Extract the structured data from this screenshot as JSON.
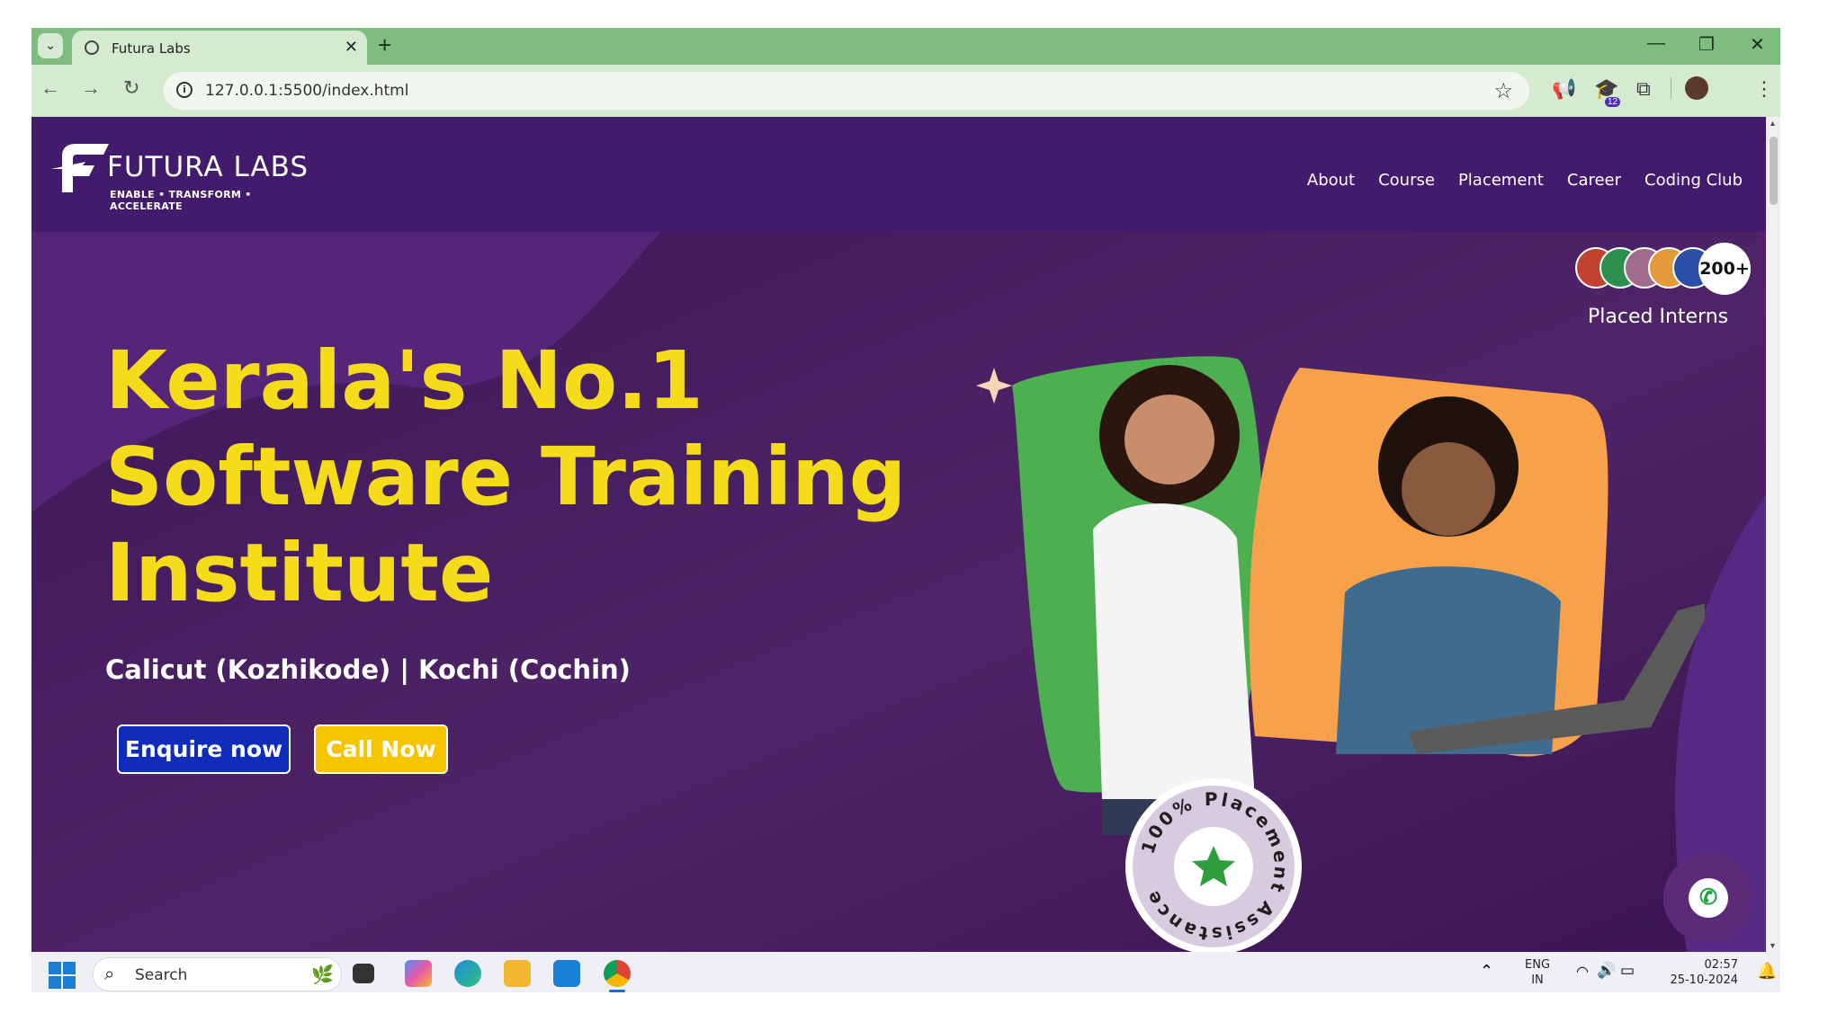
{
  "browser": {
    "tab_title": "Futura Labs",
    "new_tab": "+",
    "url": "127.0.0.1:5500/index.html",
    "extension_badge": "12"
  },
  "site": {
    "logo_name": "FUTURA LABS",
    "logo_tagline": "ENABLE • TRANSFORM • ACCELERATE",
    "nav": [
      "About",
      "Course",
      "Placement",
      "Career",
      "Coding Club"
    ],
    "hero": {
      "headline": [
        "Kerala's No.1",
        "Software Training",
        "Institute"
      ],
      "locations": "Calicut (Kozhikode) | Kochi (Cochin)",
      "enquire_label": "Enquire now",
      "call_label": "Call Now",
      "interns_count": "200+",
      "interns_label": "Placed Interns",
      "badge_text": "100% Placement Assistance"
    },
    "colors": {
      "headline": "#f5dc1a",
      "enquire_bg": "#0f2cba",
      "call_bg": "#f6c500",
      "hero_bg": "#4a1e63",
      "nav_bg": "#431b6d"
    }
  },
  "taskbar": {
    "search_placeholder": "Search",
    "lang_top": "ENG",
    "lang_bottom": "IN",
    "time": "02:57",
    "date": "25-10-2024"
  }
}
